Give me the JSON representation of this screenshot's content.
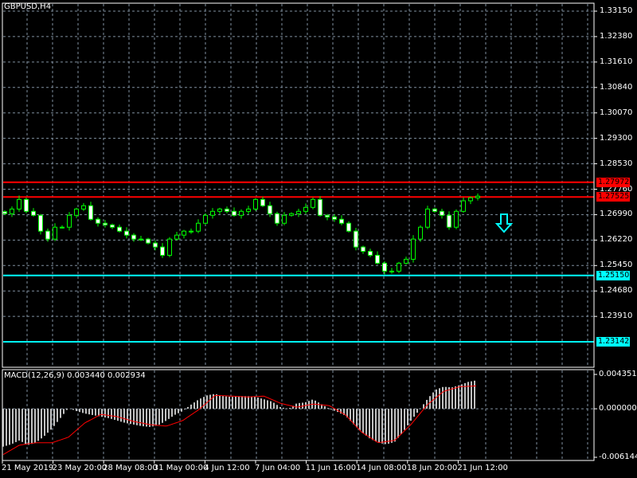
{
  "symbol_title": "GBPUSD,H4",
  "macd_title": "MACD(12,26,9) 0.003440 0.002934",
  "colors": {
    "background": "#000000",
    "bull": "#00ff00",
    "bear_body": "#ffffff",
    "grid": "#8090a0",
    "resistance": "#ff0000",
    "support": "#00ffff",
    "macd_hist": "#c0c0c0",
    "macd_signal": "#ff0000"
  },
  "price_axis": {
    "min": 1.23142,
    "max": 1.3315,
    "ticks": [
      "1.33150",
      "1.32380",
      "1.31610",
      "1.30840",
      "1.30070",
      "1.29300",
      "1.28530",
      "1.27760",
      "1.26990",
      "1.26220",
      "1.25450",
      "1.24680",
      "1.23910"
    ]
  },
  "levels": [
    {
      "price": 1.27972,
      "label": "1.27972",
      "color": "#ff0000",
      "text_color": "#000000"
    },
    {
      "price": 1.27525,
      "label": "1.27525",
      "color": "#ff0000",
      "text_color": "#000000"
    },
    {
      "price": 1.2515,
      "label": "1.25150",
      "color": "#00ffff",
      "text_color": "#000000"
    },
    {
      "price": 1.23142,
      "label": "1.23142",
      "color": "#00ffff",
      "text_color": "#000000"
    }
  ],
  "signal_arrow": {
    "direction": "down",
    "icon": "sell-arrow-icon",
    "color": "#00ffff"
  },
  "macd_axis": {
    "max": 0.004351,
    "min": -0.006144,
    "ticks": [
      "0.004351",
      "0.000000",
      "-0.006144"
    ]
  },
  "time_axis": [
    "21 May 2019",
    "23 May 20:00",
    "28 May 08:00",
    "31 May 00:00",
    "4 Jun 12:00",
    "7 Jun 04:00",
    "11 Jun 16:00",
    "14 Jun 08:00",
    "18 Jun 20:00",
    "21 Jun 12:00"
  ],
  "chart_data": {
    "type": "candlestick",
    "closes": [
      1.2702,
      1.2716,
      1.2745,
      1.2709,
      1.2697,
      1.2649,
      1.2625,
      1.2661,
      1.2661,
      1.2697,
      1.2716,
      1.2726,
      1.2685,
      1.2673,
      1.2668,
      1.2661,
      1.2649,
      1.2637,
      1.2625,
      1.2625,
      1.2613,
      1.2601,
      1.2576,
      1.2625,
      1.2637,
      1.2649,
      1.2649,
      1.2673,
      1.2697,
      1.2709,
      1.2716,
      1.2709,
      1.2697,
      1.2709,
      1.2716,
      1.2745,
      1.2726,
      1.2702,
      1.2673,
      1.2697,
      1.2702,
      1.2709,
      1.2721,
      1.2745,
      1.2697,
      1.2692,
      1.2685,
      1.2673,
      1.2649,
      1.2601,
      1.2588,
      1.2576,
      1.2552,
      1.2528,
      1.2528,
      1.2552,
      1.2564,
      1.2625,
      1.2661,
      1.2716,
      1.2709,
      1.2697,
      1.2661,
      1.2709,
      1.2741,
      1.275,
      1.2755
    ],
    "macd_histogram": [
      -0.0048,
      -0.0045,
      -0.004,
      -0.0046,
      -0.0043,
      -0.0035,
      -0.0025,
      -0.0012,
      0.0001,
      -0.0003,
      -0.0006,
      -0.0008,
      -0.001,
      -0.0012,
      -0.0015,
      -0.0018,
      -0.002,
      -0.0022,
      -0.0023,
      -0.0021,
      -0.0015,
      -0.0008,
      -0.0003,
      0.0005,
      0.0012,
      0.0017,
      0.0019,
      0.0016,
      0.0015,
      0.0016,
      0.0016,
      0.0015,
      0.0012,
      0.0009,
      0.0002,
      0.0,
      0.0007,
      0.0008,
      0.0012,
      0.0006,
      0.0,
      -0.0004,
      -0.0009,
      -0.002,
      -0.003,
      -0.0038,
      -0.0043,
      -0.0045,
      -0.0042,
      -0.003,
      -0.0015,
      -0.0002,
      0.0012,
      0.0024,
      0.0028,
      0.0027,
      0.003,
      0.0034,
      0.0036
    ],
    "macd_signal": [
      -0.0058,
      -0.0046,
      -0.0043,
      -0.0043,
      -0.0036,
      -0.0018,
      -0.0007,
      -0.001,
      -0.0016,
      -0.002,
      -0.0022,
      -0.0015,
      -0.0001,
      0.0017,
      0.0016,
      0.0015,
      0.0016,
      0.0007,
      0.0002,
      0.0006,
      0.0004,
      -0.0008,
      -0.003,
      -0.0043,
      -0.004,
      -0.002,
      0.0005,
      0.0022,
      0.0028,
      0.0029
    ]
  }
}
